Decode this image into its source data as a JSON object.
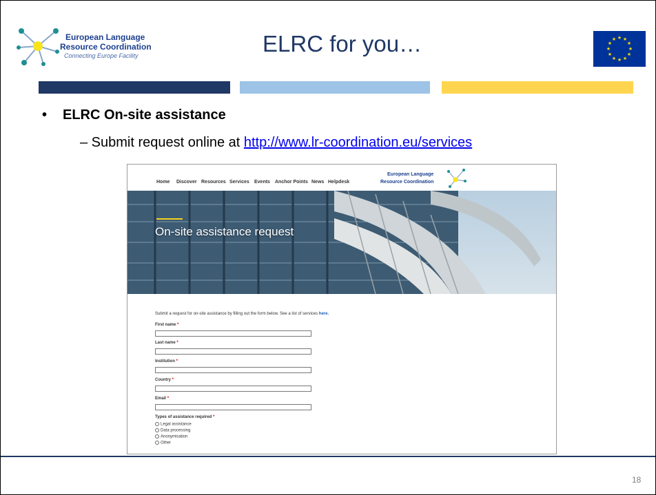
{
  "header": {
    "logo_line1": "European Language",
    "logo_line2": "Resource Coordination",
    "logo_line3": "Connecting Europe Facility",
    "title": "ELRC for you…"
  },
  "colors": {
    "dark_blue": "#1f3864",
    "light_blue": "#9dc3e6",
    "yellow": "#ffd54f",
    "eu_blue": "#003399",
    "eu_star": "#ffdd00"
  },
  "content": {
    "bullet_symbol": "•",
    "bullet_label": "ELRC On-site assistance",
    "sub_prefix": "– Submit request online at ",
    "sub_link": "http://www.lr-coordination.eu/services"
  },
  "website": {
    "nav": [
      "Home",
      "Discover",
      "Resources",
      "Services",
      "Events",
      "Anchor Points",
      "News",
      "Helpdesk"
    ],
    "logo_line1": "European Language",
    "logo_line2": "Resource Coordination",
    "hero_title": "On-site assistance request",
    "intro_text": "Submit a request for on-site assistance by filling out the form below. See a list of services ",
    "intro_link": "here.",
    "fields": [
      "First name",
      "Last name",
      "Institution",
      "Country",
      "Email"
    ],
    "required_mark": "*",
    "types_label": "Types of assistance required",
    "types_options": [
      "Legal assistance",
      "Data processing",
      "Anonymisation",
      "Other"
    ]
  },
  "footer": {
    "page_number": "18"
  }
}
